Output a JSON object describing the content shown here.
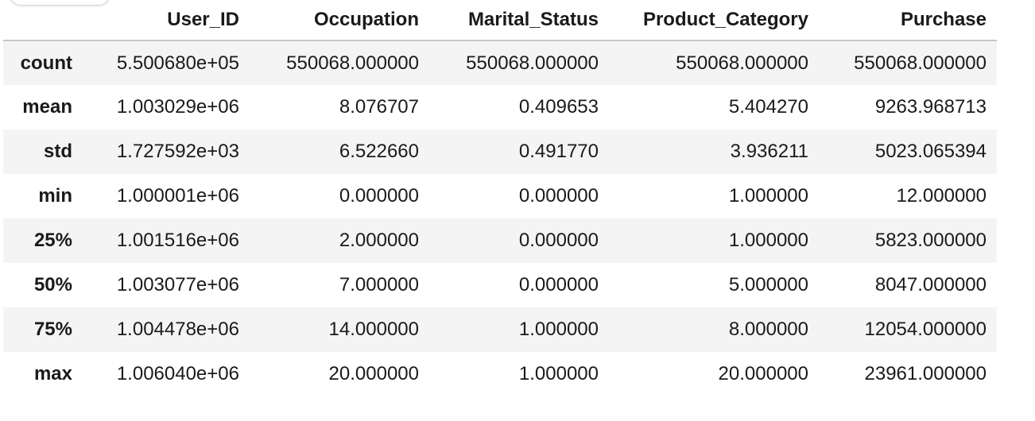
{
  "table": {
    "columns": [
      "",
      "User_ID",
      "Occupation",
      "Marital_Status",
      "Product_Category",
      "Purchase"
    ],
    "rows": [
      {
        "label": "count",
        "values": [
          "5.500680e+05",
          "550068.000000",
          "550068.000000",
          "550068.000000",
          "550068.000000"
        ]
      },
      {
        "label": "mean",
        "values": [
          "1.003029e+06",
          "8.076707",
          "0.409653",
          "5.404270",
          "9263.968713"
        ]
      },
      {
        "label": "std",
        "values": [
          "1.727592e+03",
          "6.522660",
          "0.491770",
          "3.936211",
          "5023.065394"
        ]
      },
      {
        "label": "min",
        "values": [
          "1.000001e+06",
          "0.000000",
          "0.000000",
          "1.000000",
          "12.000000"
        ]
      },
      {
        "label": "25%",
        "values": [
          "1.001516e+06",
          "2.000000",
          "0.000000",
          "1.000000",
          "5823.000000"
        ]
      },
      {
        "label": "50%",
        "values": [
          "1.003077e+06",
          "7.000000",
          "0.000000",
          "5.000000",
          "8047.000000"
        ]
      },
      {
        "label": "75%",
        "values": [
          "1.004478e+06",
          "14.000000",
          "1.000000",
          "8.000000",
          "12054.000000"
        ]
      },
      {
        "label": "max",
        "values": [
          "1.006040e+06",
          "20.000000",
          "1.000000",
          "20.000000",
          "23961.000000"
        ]
      }
    ]
  }
}
